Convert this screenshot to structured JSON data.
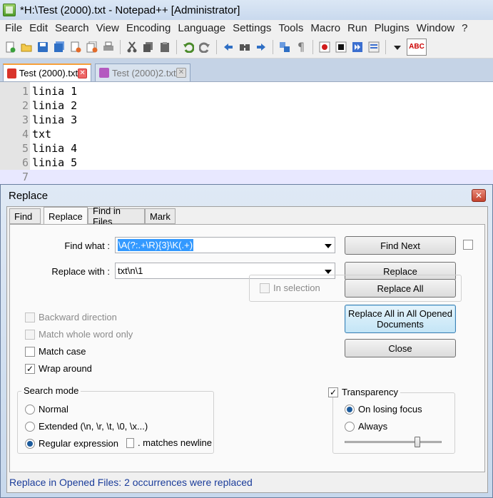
{
  "window": {
    "title": "*H:\\Test (2000).txt - Notepad++ [Administrator]"
  },
  "menu": [
    "File",
    "Edit",
    "Search",
    "View",
    "Encoding",
    "Language",
    "Settings",
    "Tools",
    "Macro",
    "Run",
    "Plugins",
    "Window",
    "?"
  ],
  "toolbar": {
    "icons": [
      "new-file-icon",
      "open-file-icon",
      "save-icon",
      "save-all-icon",
      "close-icon",
      "close-all-icon",
      "print-icon",
      "cut-icon",
      "copy-icon",
      "paste-icon",
      "undo-icon",
      "redo-icon",
      "find-icon",
      "find-replace-icon",
      "zoom-in-icon",
      "sync-scroll-icon",
      "show-all-chars-icon",
      "record-macro-icon",
      "stop-macro-icon",
      "play-macro-icon",
      "save-macro-icon",
      "dropdown-icon",
      "spellcheck-icon"
    ],
    "spellcheck_label": "ABC"
  },
  "tabs": [
    {
      "label": "Test (2000).txt",
      "active": true
    },
    {
      "label": "Test (2000)2.txt",
      "active": false
    }
  ],
  "editor": {
    "lines": [
      {
        "num": "1",
        "text": "linia 1"
      },
      {
        "num": "2",
        "text": "linia 2"
      },
      {
        "num": "3",
        "text": "linia 3"
      },
      {
        "num": "4",
        "text": "txt"
      },
      {
        "num": "5",
        "text": "linia 4"
      },
      {
        "num": "6",
        "text": "linia 5"
      },
      {
        "num": "7",
        "text": ""
      }
    ]
  },
  "dialog": {
    "title": "Replace",
    "tabs": [
      "Find",
      "Replace",
      "Find in Files",
      "Mark"
    ],
    "active_tab": "Replace",
    "find_label": "Find what :",
    "find_value": "\\A(?:.+\\R){3}\\K(.+)",
    "replace_label": "Replace with :",
    "replace_value": "txt\\n\\1",
    "buttons": {
      "find_next": "Find Next",
      "replace": "Replace",
      "replace_all": "Replace All",
      "replace_all_opened": "Replace All in All Opened Documents",
      "close": "Close"
    },
    "in_selection": {
      "label": "In selection",
      "checked": false
    },
    "options": [
      {
        "key": "backward",
        "label": "Backward direction",
        "checked": false,
        "enabled": false
      },
      {
        "key": "whole_word",
        "label": "Match whole word only",
        "checked": false,
        "enabled": false
      },
      {
        "key": "match_case",
        "label": "Match case",
        "checked": false,
        "enabled": true
      },
      {
        "key": "wrap_around",
        "label": "Wrap around",
        "checked": true,
        "enabled": true
      }
    ],
    "search_mode": {
      "title": "Search mode",
      "normal": "Normal",
      "extended": "Extended (\\n, \\r, \\t, \\0, \\x...)",
      "regex": "Regular expression",
      "selected": "regex",
      "matches_newline": ". matches newline"
    },
    "transparency": {
      "label": "Transparency",
      "checked": true,
      "on_losing_focus": "On losing focus",
      "always": "Always",
      "selected": "on_losing_focus",
      "level": 0.75
    },
    "status": "Replace in Opened Files: 2 occurrences were replaced"
  }
}
